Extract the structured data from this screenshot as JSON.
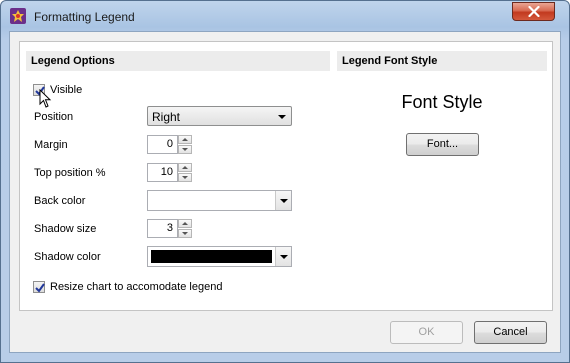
{
  "window": {
    "title": "Formatting Legend"
  },
  "legend_options": {
    "header": "Legend Options",
    "visible": {
      "label": "Visible",
      "checked": true
    },
    "position": {
      "label": "Position",
      "value": "Right"
    },
    "margin": {
      "label": "Margin",
      "value": "0"
    },
    "top_position": {
      "label": "Top position %",
      "value": "10"
    },
    "back_color": {
      "label": "Back color",
      "color": "#ffffff"
    },
    "shadow_size": {
      "label": "Shadow size",
      "value": "3"
    },
    "shadow_color": {
      "label": "Shadow color",
      "color": "#000000"
    },
    "resize": {
      "label": "Resize chart to accomodate legend",
      "checked": true
    }
  },
  "legend_font_style": {
    "header": "Legend Font Style",
    "preview": "Font Style",
    "font_button": "Font..."
  },
  "footer": {
    "ok": "OK",
    "cancel": "Cancel"
  },
  "icons": {
    "app": "app-logo-icon",
    "close": "close-icon",
    "check": "checkmark-icon",
    "pointer": "mouse-pointer-icon"
  }
}
